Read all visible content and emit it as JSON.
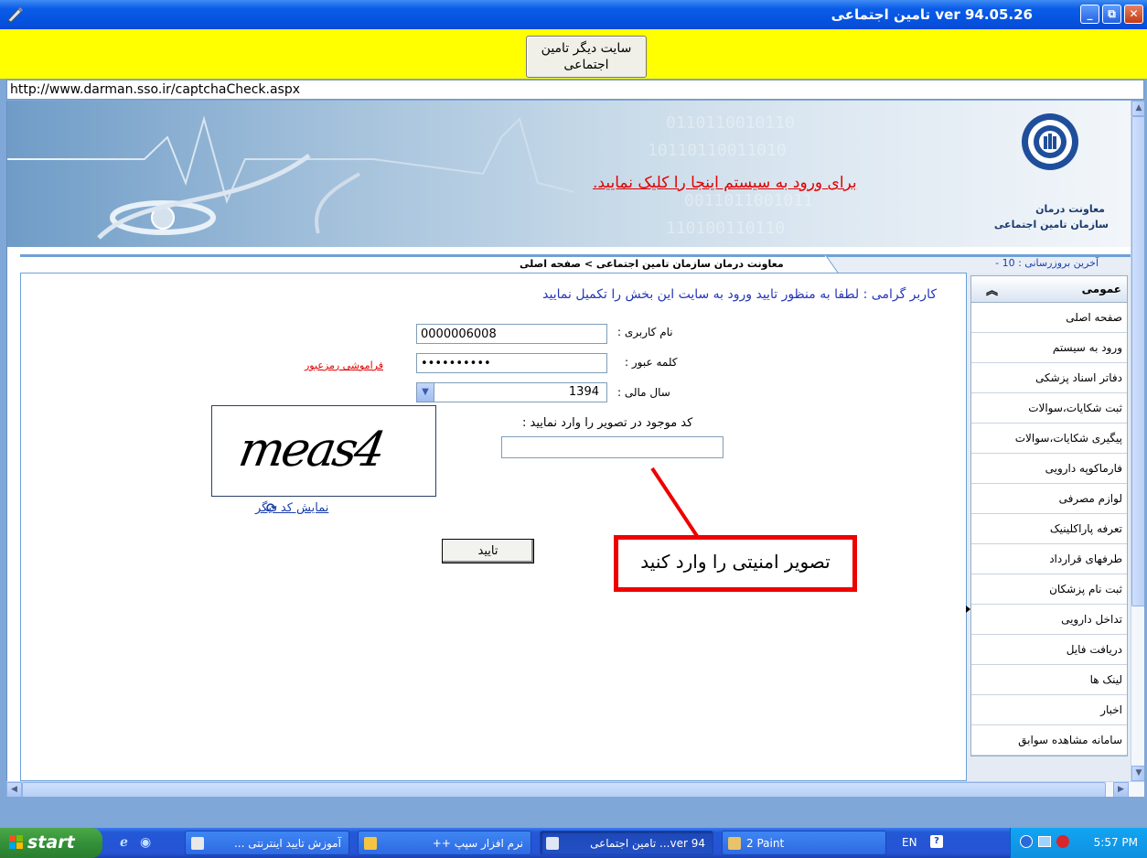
{
  "window": {
    "title": "ver 94.05.26 تامین اجتماعی",
    "buttons": {
      "minimize": "_",
      "restore": "⧉",
      "close": "✕"
    }
  },
  "toolbar": {
    "other_site_label": "سایت دیگر تامین اجتماعی",
    "url": "http://www.darman.sso.ir/captchaCheck.aspx"
  },
  "banner": {
    "login_link": "برای ورود به سیستم اینجا را کلیک نمایید.",
    "logo_line1": "معاونت درمان",
    "logo_line2": "سازمان تامین اجتماعی"
  },
  "breadcrumb": {
    "text": "معاونت درمان سازمان تامین اجتماعی > صفحه اصلی",
    "last_update": "آخرین بروزرسانی : 10 -"
  },
  "form": {
    "intro": "کاربر گرامی : لطفا به منظور تایید ورود به سایت این بخش را تکمیل نمایید",
    "username_label": "نام کاربری :",
    "username_value": "0000006008",
    "password_label": "کلمه عبور :",
    "password_value": "••••••••••",
    "forgot_link": "فراموشی رمزعبور",
    "year_label": "سال مالی :",
    "year_value": "1394",
    "captcha_label": "کد موجود در تصویر را وارد نمایید :",
    "captcha_image_text": "meas4",
    "captcha_input_value": "",
    "refresh_link": "نمایش کد دیگر",
    "submit_label": "تایید"
  },
  "annotation": {
    "text": "تصویر امنیتی را وارد کنید",
    "color": "#ee0000"
  },
  "sidebar": {
    "title": "عمومی",
    "chevron": "«",
    "items": [
      {
        "label": "صفحه اصلی"
      },
      {
        "label": "ورود به سیستم"
      },
      {
        "label": "دفاتر اسناد پزشکی"
      },
      {
        "label": "ثبت شکایات،سوالات"
      },
      {
        "label": "پیگیری شکایات،سوالات"
      },
      {
        "label": "فارماکوپه دارویی"
      },
      {
        "label": "لوازم مصرفی"
      },
      {
        "label": "تعرفه پاراکلینیک"
      },
      {
        "label": "طرفهای قرارداد"
      },
      {
        "label": "ثبت نام پزشکان"
      },
      {
        "label": "تداخل دارویی"
      },
      {
        "label": "دریافت فایل"
      },
      {
        "label": "لینک ها"
      },
      {
        "label": "اخبار"
      },
      {
        "label": "سامانه مشاهده سوابق"
      }
    ]
  },
  "taskbar": {
    "start_label": "start",
    "tasks": [
      {
        "label": "آموزش تایید اینترنتی ...",
        "icon_color": "#e9e9e9"
      },
      {
        "label": "نرم افزار سپپ ++",
        "icon_color": "#f5c542"
      },
      {
        "label": "ver 94... تامین اجتماعی",
        "icon_color": "#dfe6f5"
      },
      {
        "label": "2 Paint",
        "icon_color": "#e8c36a"
      }
    ],
    "lang": "EN",
    "clock": "5:57 PM"
  }
}
